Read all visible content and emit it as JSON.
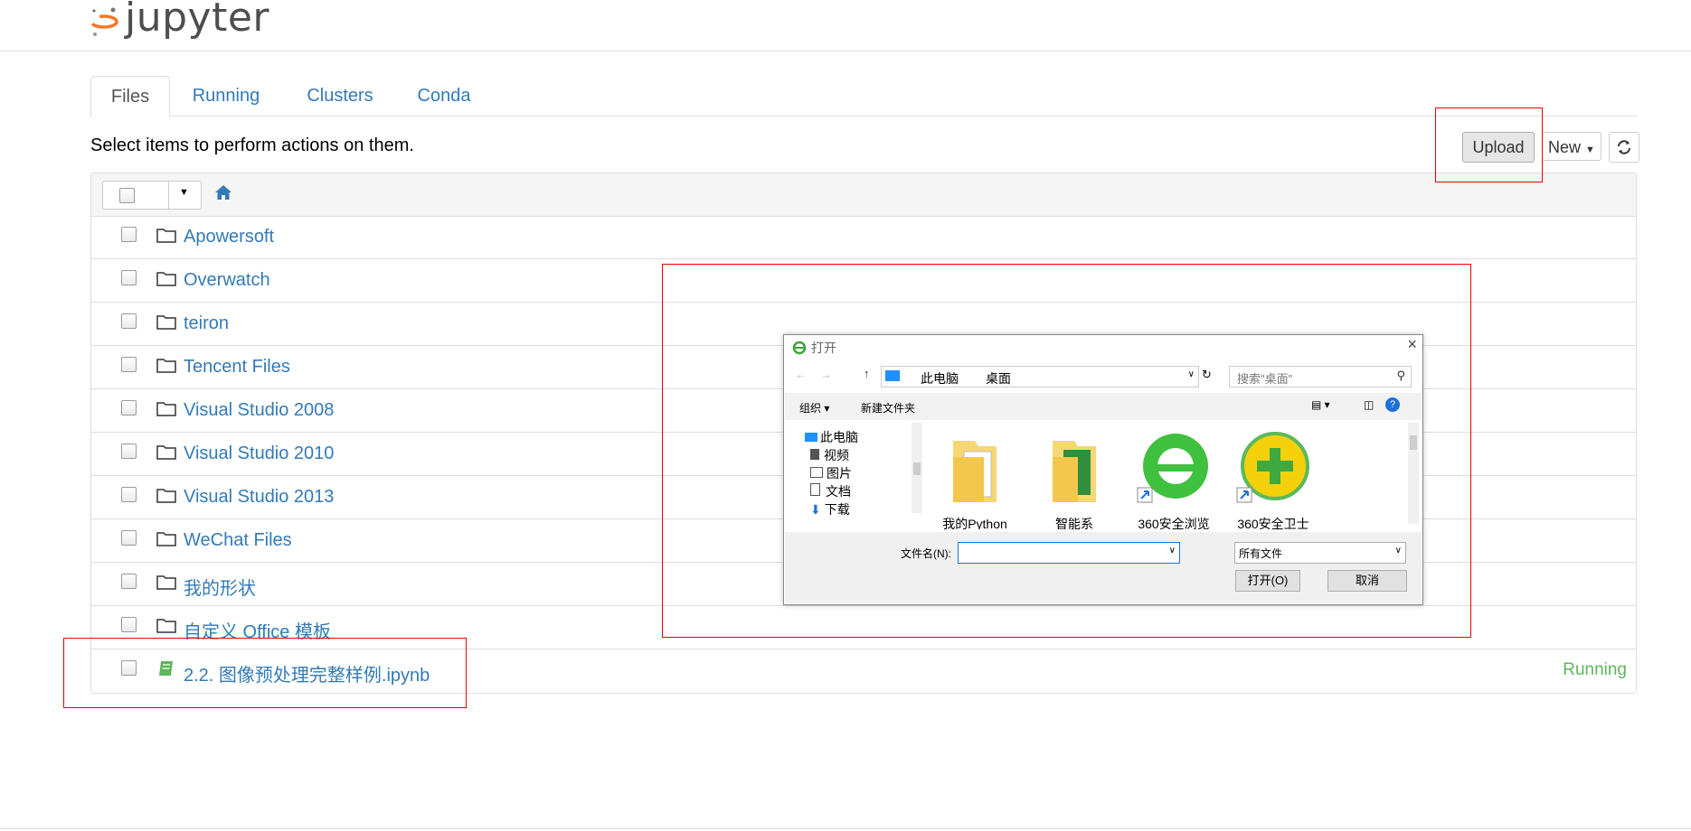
{
  "header": {
    "logo_text": "jupyter"
  },
  "tabs": [
    {
      "label": "Files",
      "active": true
    },
    {
      "label": "Running",
      "active": false
    },
    {
      "label": "Clusters",
      "active": false
    },
    {
      "label": "Conda",
      "active": false
    }
  ],
  "toolbar": {
    "hint": "Select items to perform actions on them.",
    "upload_label": "Upload",
    "new_label": "New"
  },
  "files": [
    {
      "name": "Apowersoft",
      "kind": "folder"
    },
    {
      "name": "Overwatch",
      "kind": "folder"
    },
    {
      "name": "teiron",
      "kind": "folder"
    },
    {
      "name": "Tencent Files",
      "kind": "folder"
    },
    {
      "name": "Visual Studio 2008",
      "kind": "folder"
    },
    {
      "name": "Visual Studio 2010",
      "kind": "folder"
    },
    {
      "name": "Visual Studio 2013",
      "kind": "folder"
    },
    {
      "name": "WeChat Files",
      "kind": "folder"
    },
    {
      "name": "我的形状",
      "kind": "folder"
    },
    {
      "name": "自定义 Office 模板",
      "kind": "folder"
    },
    {
      "name": "2.2. 图像预处理完整样例.ipynb",
      "kind": "notebook",
      "status": "Running"
    }
  ],
  "dialog": {
    "title": "打开",
    "address": [
      "此电脑",
      "桌面"
    ],
    "search_placeholder": "搜索\"桌面\"",
    "organize_label": "组织 ▾",
    "new_folder_label": "新建文件夹",
    "tree": [
      "此电脑",
      "视频",
      "图片",
      "文档",
      "下载"
    ],
    "tiles": [
      "我的Python",
      "智能系",
      "360安全浏览",
      "360安全卫士"
    ],
    "filename_label": "文件名(N):",
    "filetype_value": "所有文件",
    "open_label": "打开(O)",
    "cancel_label": "取消"
  },
  "colors": {
    "link": "#337ab7",
    "running": "#5cb85c",
    "annotation": "#e00000",
    "logo_orange": "#f37726"
  }
}
